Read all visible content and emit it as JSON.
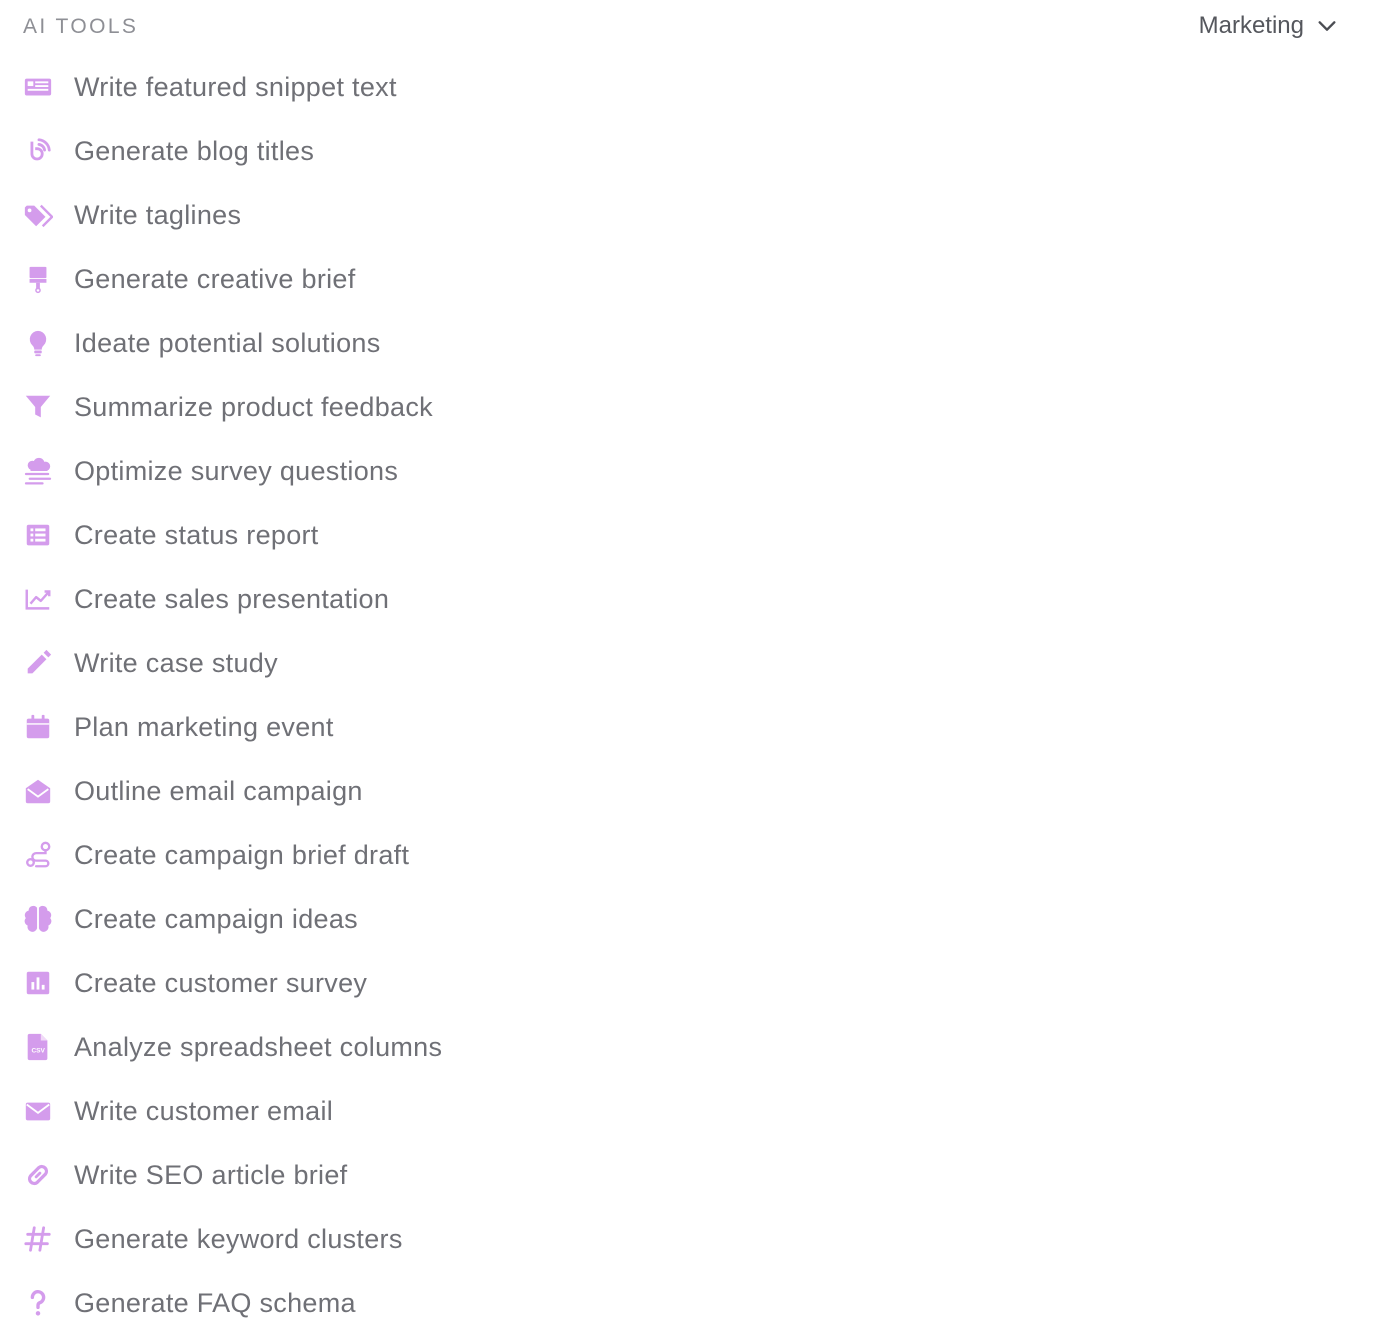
{
  "header": {
    "section_title": "AI TOOLS",
    "category_value": "Marketing",
    "category_icon": "chevron-down-icon"
  },
  "accent_color": "#d49cec",
  "tools": [
    {
      "label": "Write featured snippet text",
      "icon": "newspaper-icon"
    },
    {
      "label": "Generate blog titles",
      "icon": "blog-icon"
    },
    {
      "label": "Write taglines",
      "icon": "tags-icon"
    },
    {
      "label": "Generate creative brief",
      "icon": "paint-brush-icon"
    },
    {
      "label": "Ideate potential solutions",
      "icon": "lightbulb-icon"
    },
    {
      "label": "Summarize product feedback",
      "icon": "filter-icon"
    },
    {
      "label": "Optimize survey questions",
      "icon": "smog-icon"
    },
    {
      "label": "Create status report",
      "icon": "list-alt-icon"
    },
    {
      "label": "Create sales presentation",
      "icon": "chart-line-icon"
    },
    {
      "label": "Write case study",
      "icon": "pencil-icon"
    },
    {
      "label": "Plan marketing event",
      "icon": "calendar-icon"
    },
    {
      "label": "Outline email campaign",
      "icon": "envelope-open-icon"
    },
    {
      "label": "Create campaign brief draft",
      "icon": "route-icon"
    },
    {
      "label": "Create campaign ideas",
      "icon": "brain-icon"
    },
    {
      "label": "Create customer survey",
      "icon": "poll-icon"
    },
    {
      "label": "Analyze spreadsheet columns",
      "icon": "file-csv-icon"
    },
    {
      "label": "Write customer email",
      "icon": "envelope-icon"
    },
    {
      "label": "Write SEO article brief",
      "icon": "link-icon"
    },
    {
      "label": "Generate keyword clusters",
      "icon": "hashtag-icon"
    },
    {
      "label": "Generate FAQ schema",
      "icon": "question-icon"
    }
  ]
}
